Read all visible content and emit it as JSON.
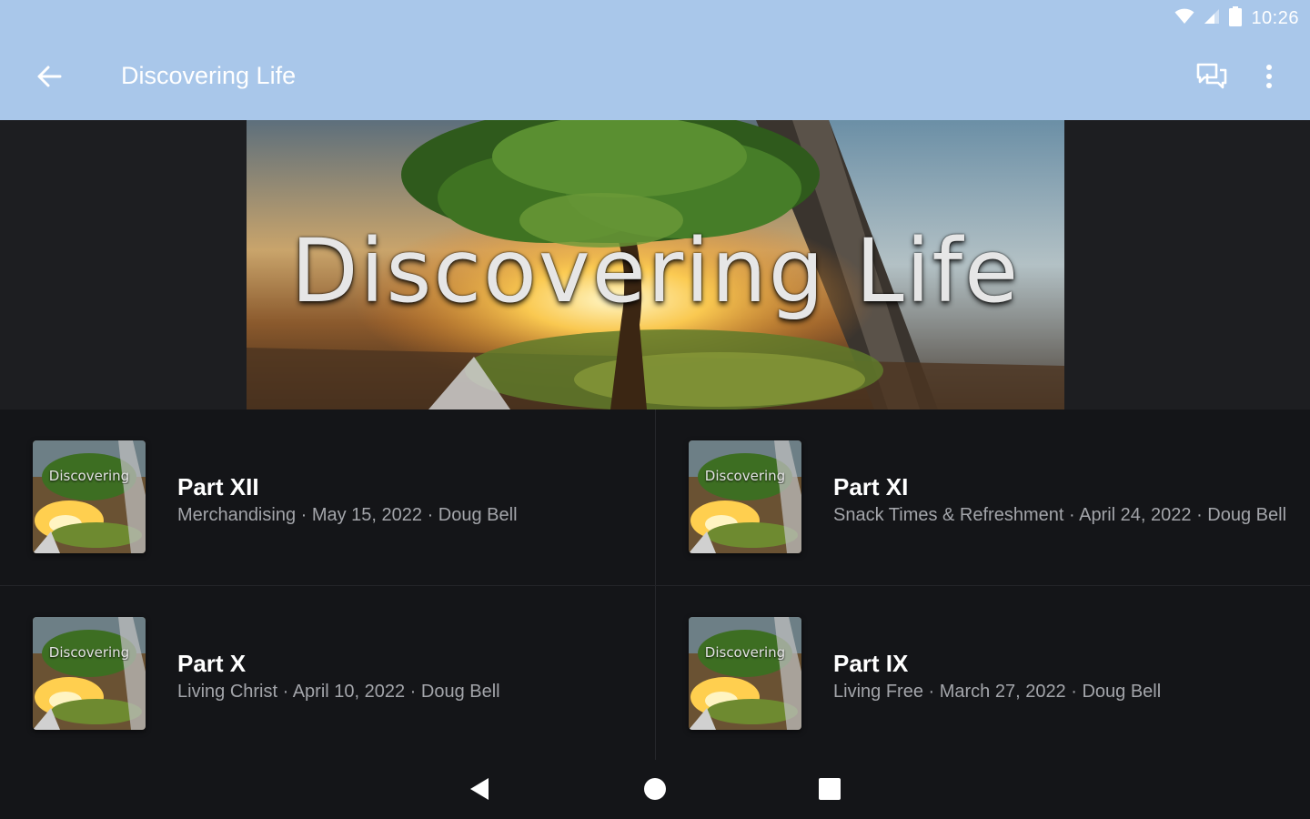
{
  "status_bar": {
    "time": "10:26",
    "icons": [
      "wifi-icon",
      "cellular-signal-icon",
      "battery-icon"
    ]
  },
  "app_bar": {
    "title": "Discovering Life",
    "icons": [
      "back-arrow-icon",
      "chat-icon",
      "more-vert-icon"
    ]
  },
  "hero": {
    "title": "Discovering Life"
  },
  "episodes": [
    {
      "title": "Part XII",
      "subtitle": "Merchandising · May 15, 2022 · Doug Bell",
      "thumb_text": "Discovering"
    },
    {
      "title": "Part XI",
      "subtitle": "Snack Times & Refreshment · April 24, 2022 · Doug Bell",
      "thumb_text": "Discovering"
    },
    {
      "title": "Part X",
      "subtitle": "Living Christ · April 10, 2022 · Doug Bell",
      "thumb_text": "Discovering"
    },
    {
      "title": "Part IX",
      "subtitle": "Living Free · March 27, 2022 · Doug Bell",
      "thumb_text": "Discovering"
    }
  ],
  "nav_bar": {
    "icons": [
      "nav-back-icon",
      "nav-home-icon",
      "nav-recents-icon"
    ]
  },
  "colors": {
    "app_bar": "#a9c7ea",
    "background": "#141518",
    "title_text": "#ffffff",
    "subtitle_text": "#a3a5aa"
  }
}
